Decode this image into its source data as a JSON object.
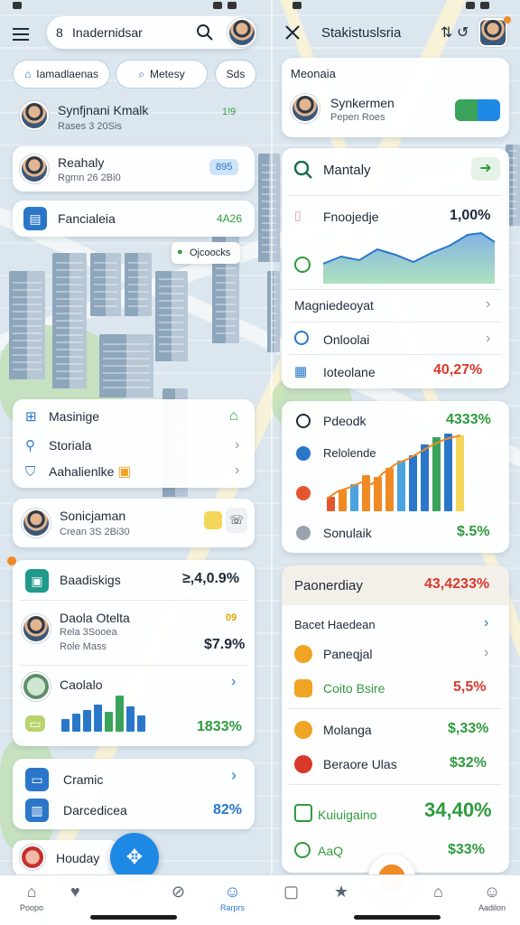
{
  "left": {
    "search": {
      "value": "Inadernidsar"
    },
    "filters": [
      "Iamadlaenas",
      "Metesy",
      "Sds"
    ],
    "header_contact": {
      "name": "Synfjnani Kmalk",
      "sub": "Rases 3 20Sis",
      "badge": "1!9"
    },
    "card_person": {
      "name": "Reahaly",
      "sub": "Rgmn 26 2Bi0",
      "badge": "895"
    },
    "card_metric": {
      "label": "Fancialeia",
      "value": "4A26"
    },
    "map_label": "Ojcoocks",
    "menu": {
      "items": [
        {
          "label": "Masinige"
        },
        {
          "label": "Storiala"
        },
        {
          "label": "Aahalienlke"
        }
      ]
    },
    "card_contact2": {
      "name": "Sonicjaman",
      "sub": "Crean 3S 2Bi30"
    },
    "summary": {
      "title": "Baadiskigs",
      "title_value": "≥,4,0.9%",
      "person_name": "Daola Otelta",
      "person_sub1": "Rela 3Sooea",
      "person_sub2": "Role Mass",
      "person_badge": "09",
      "person_value": "$7.9%",
      "chart_label": "Caolalo",
      "chart_value": "1833%"
    },
    "card_bottom": {
      "row1": "Cramic",
      "row2": "Darcedicea",
      "row2_value": "82%"
    },
    "partial": {
      "label": "Houday"
    }
  },
  "right": {
    "title": "Stakistuslsria",
    "contact_header": {
      "section": "Meonaia",
      "name": "Synkermen",
      "sub": "Pepen Roes"
    },
    "metrics": {
      "title": "Mantaly",
      "row1_label": "Fnoojedje",
      "row1_value": "1,00%",
      "section2": "Magniedeoyat",
      "row3_label": "Onloolai",
      "row4_label": "Ioteolane",
      "row4_value": "40,27%"
    },
    "card2": {
      "title": "Pdeodk",
      "title_value": "4333%",
      "row2_label": "Relolende",
      "row4_label": "Sonulaik",
      "row4_value": "$.5%"
    },
    "card3": {
      "title": "Paonerdiay",
      "title_value": "43,4233%",
      "rows": [
        {
          "label": "Bacet Haedean",
          "value": ""
        },
        {
          "label": "Paneqjal",
          "value": ""
        },
        {
          "label": "Coito Bsire",
          "value": "5,5%"
        },
        {
          "label": "Molanga",
          "value": "$,33%"
        },
        {
          "label": "Beraore Ulas",
          "value": "$32%"
        }
      ],
      "total_label": "Kuiuigaino",
      "total_value": "34,40%",
      "footer_label": "AaQ",
      "footer_value": "$33%"
    }
  },
  "nav": {
    "items": [
      {
        "label": "Poopo"
      },
      {
        "label": ""
      },
      {
        "label": ""
      },
      {
        "label": "Rarprs"
      },
      {
        "label": ""
      },
      {
        "label": ""
      },
      {
        "label": ""
      },
      {
        "label": "Aadilon"
      }
    ]
  },
  "colors": {
    "accent": "#1e88e5",
    "green": "#2e9b3c",
    "red": "#d8392b",
    "orange": "#f08a24"
  }
}
